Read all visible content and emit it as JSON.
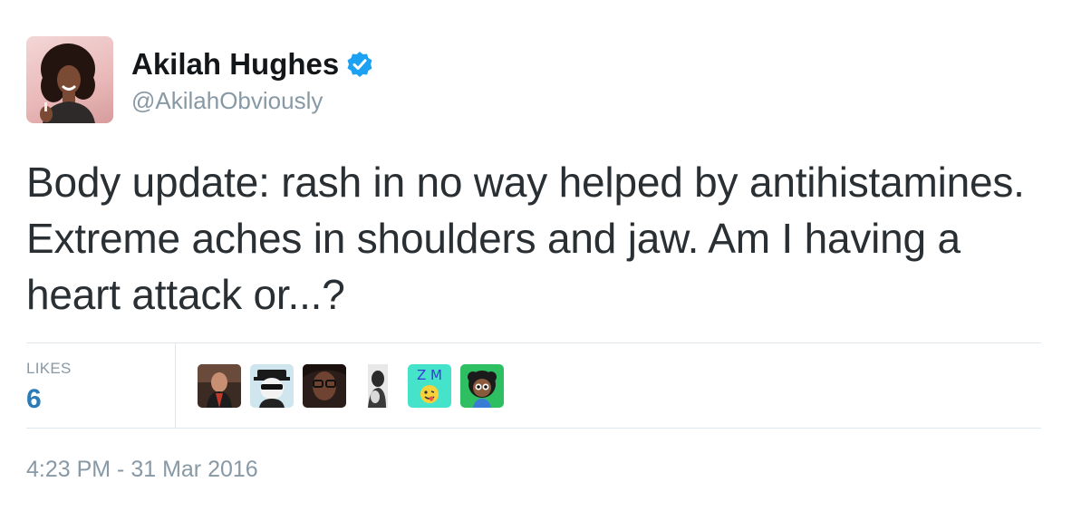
{
  "author": {
    "name": "Akilah Hughes",
    "handle": "@AkilahObviously",
    "verified_icon": "verified-badge-icon",
    "avatar_icon": "profile-avatar"
  },
  "tweet": {
    "text": "Body update: rash in no way helped by antihistamines. Extreme aches in shoulders and jaw. Am I having a heart attack or...?"
  },
  "stats": {
    "likes_label": "LIKES",
    "likes_count": "6"
  },
  "likers": [
    {
      "name": "liker-avatar-1"
    },
    {
      "name": "liker-avatar-2"
    },
    {
      "name": "liker-avatar-3"
    },
    {
      "name": "liker-avatar-4"
    },
    {
      "name": "liker-avatar-5",
      "initials": "Z M"
    },
    {
      "name": "liker-avatar-6"
    }
  ],
  "timestamp": "4:23 PM - 31 Mar 2016",
  "colors": {
    "verified": "#1da1f2",
    "likes_count": "#2b7bb9",
    "muted": "#8899a6",
    "divider": "#e1e8ed"
  }
}
